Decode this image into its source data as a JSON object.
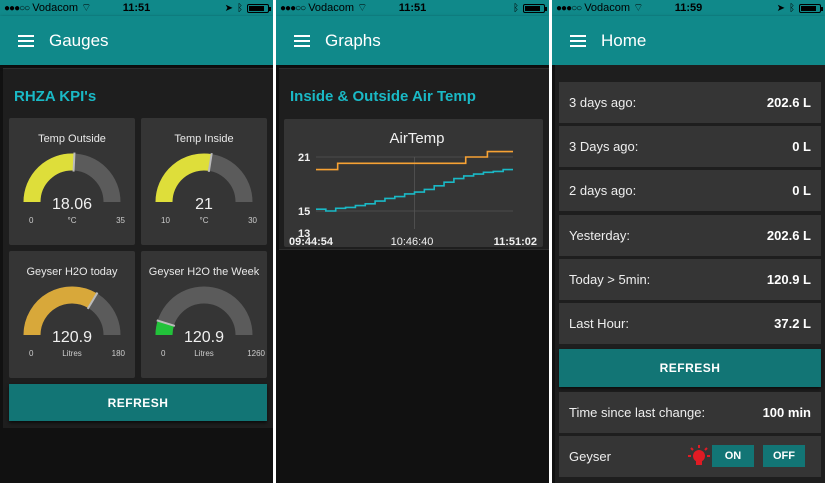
{
  "status": {
    "carrier": "Vodacom",
    "signal_dots": "●●●○○",
    "time1": "11:51",
    "time2": "11:51",
    "time3": "11:59"
  },
  "screen1": {
    "title": "Gauges",
    "group_title": "RHZA KPI's",
    "gauges": [
      {
        "title": "Temp Outside",
        "value": "18.06",
        "unit": "°C",
        "min": "0",
        "max": "35",
        "fraction": 0.516,
        "color": "#dede3a"
      },
      {
        "title": "Temp Inside",
        "value": "21",
        "unit": "°C",
        "min": "10",
        "max": "30",
        "fraction": 0.55,
        "color": "#dede3a"
      },
      {
        "title": "Geyser H2O today",
        "value": "120.9",
        "unit": "Litres",
        "min": "0",
        "max": "180",
        "fraction": 0.672,
        "color": "#d8a83a"
      },
      {
        "title": "Geyser H2O the Week",
        "value": "120.9",
        "unit": "Litres",
        "min": "0",
        "max": "1260",
        "fraction": 0.096,
        "color": "#22c23a"
      }
    ],
    "refresh_label": "REFRESH"
  },
  "screen2": {
    "title": "Graphs",
    "group_title": "Inside & Outside Air Temp",
    "chart_data": {
      "type": "line",
      "title": "AirTemp",
      "ylim": [
        13,
        21
      ],
      "y_ticks": [
        "21",
        "15",
        "13"
      ],
      "x_ticks": [
        "09:44:54",
        "10:46:40",
        "11:51:02"
      ],
      "grid": true,
      "series": [
        {
          "color": "#f7a234",
          "x": [
            0,
            0.11,
            0.11,
            0.38,
            0.38,
            0.76,
            0.76,
            0.87,
            0.87,
            1.0
          ],
          "y": [
            19.6,
            19.6,
            20.3,
            20.3,
            20.3,
            20.3,
            21.0,
            21.0,
            21.6,
            21.6
          ]
        },
        {
          "color": "#1ab9c6",
          "x": [
            0,
            0.05,
            0.1,
            0.15,
            0.2,
            0.25,
            0.3,
            0.35,
            0.4,
            0.45,
            0.5,
            0.55,
            0.6,
            0.65,
            0.7,
            0.75,
            0.8,
            0.85,
            0.9,
            0.95,
            1.0
          ],
          "y": [
            15.2,
            15.0,
            15.3,
            15.4,
            15.6,
            15.8,
            16.1,
            16.4,
            16.6,
            16.9,
            17.1,
            17.4,
            17.8,
            18.2,
            18.6,
            18.9,
            19.1,
            19.3,
            19.4,
            19.6,
            19.6
          ]
        }
      ]
    }
  },
  "screen3": {
    "title": "Home",
    "rows": [
      {
        "label": "3 days ago:",
        "value": "202.6 L"
      },
      {
        "label": "3 Days ago:",
        "value": "0 L"
      },
      {
        "label": "2 days ago:",
        "value": "0 L"
      },
      {
        "label": "Yesterday:",
        "value": "202.6 L"
      },
      {
        "label": "Today > 5min:",
        "value": "120.9 L"
      },
      {
        "label": "Last Hour:",
        "value": "37.2 L"
      }
    ],
    "refresh_label": "REFRESH",
    "time_since_label": "Time since last change:",
    "time_since_value": "100 min",
    "geyser_label": "Geyser",
    "on_label": "ON",
    "off_label": "OFF"
  }
}
